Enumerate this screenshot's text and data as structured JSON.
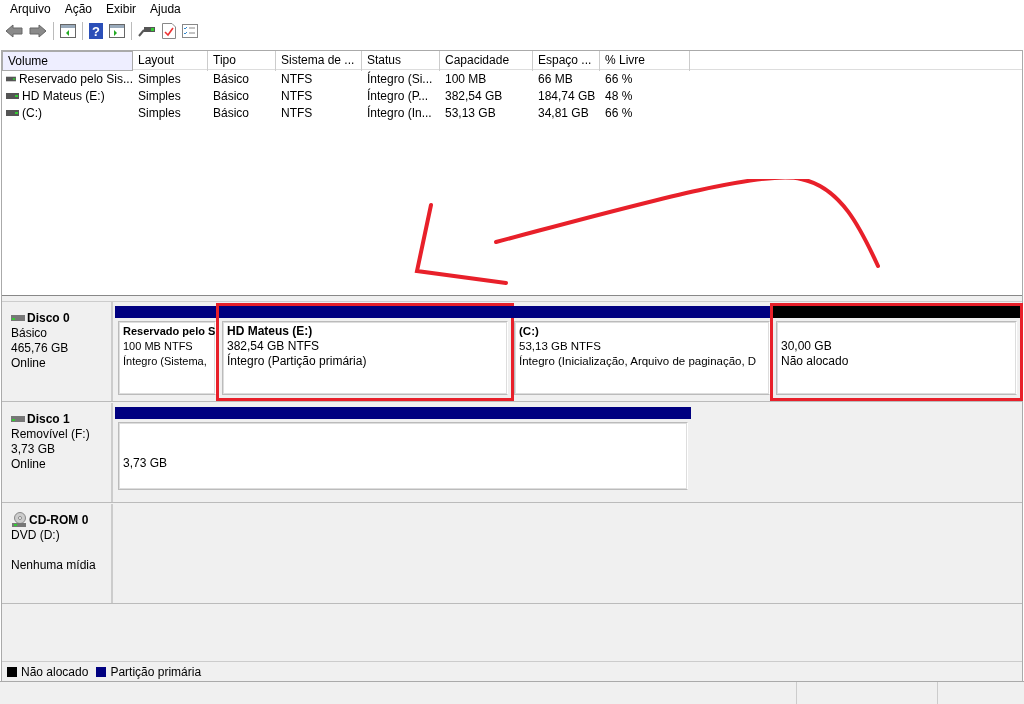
{
  "menu": [
    "Arquivo",
    "Ação",
    "Exibir",
    "Ajuda"
  ],
  "toolbar": {
    "help_icon": "?"
  },
  "table": {
    "columns": [
      "Volume",
      "Layout",
      "Tipo",
      "Sistema de ...",
      "Status",
      "Capacidade",
      "Espaço ...",
      "% Livre"
    ],
    "rows": [
      {
        "cells": [
          "Reservado pelo Sis...",
          "Simples",
          "Básico",
          "NTFS",
          "Íntegro (Si...",
          "100 MB",
          "66 MB",
          "66 %"
        ]
      },
      {
        "cells": [
          "HD Mateus (E:)",
          "Simples",
          "Básico",
          "NTFS",
          "Íntegro (P...",
          "382,54 GB",
          "184,74 GB",
          "48 %"
        ]
      },
      {
        "cells": [
          " (C:)",
          "Simples",
          "Básico",
          "NTFS",
          "Íntegro (In...",
          "53,13 GB",
          "34,81 GB",
          "66 %"
        ]
      }
    ]
  },
  "disks": [
    {
      "kind": "disk",
      "name": "Disco 0",
      "lines": [
        "Básico",
        "465,76 GB",
        "Online"
      ],
      "partitions": [
        {
          "kind": "primary",
          "highlighted": false,
          "name": "Reservado pelo S",
          "size": "100 MB NTFS",
          "status": "Íntegro (Sistema,"
        },
        {
          "kind": "primary",
          "highlighted": true,
          "name": "HD Mateus  (E:)",
          "size": "382,54 GB NTFS",
          "status": "Íntegro (Partição primária)"
        },
        {
          "kind": "primary",
          "highlighted": false,
          "name": " (C:)",
          "size": "53,13 GB NTFS",
          "status": "Íntegro (Inicialização, Arquivo de paginação, D"
        },
        {
          "kind": "unallocated",
          "highlighted": true,
          "size": "30,00 GB",
          "status": "Não alocado"
        }
      ]
    },
    {
      "kind": "disk",
      "name": "Disco 1",
      "lines": [
        "Removível (F:)",
        "3,73 GB",
        "Online"
      ],
      "partitions": [
        {
          "kind": "primary",
          "highlighted": false,
          "size": "3,73 GB"
        }
      ]
    },
    {
      "kind": "cdrom",
      "name": "CD-ROM 0",
      "lines": [
        "DVD (D:)",
        "Nenhuma mídia"
      ]
    }
  ],
  "legend": [
    {
      "label": "Não alocado",
      "color": "#000000"
    },
    {
      "label": "Partição primária",
      "color": "#000080"
    }
  ]
}
